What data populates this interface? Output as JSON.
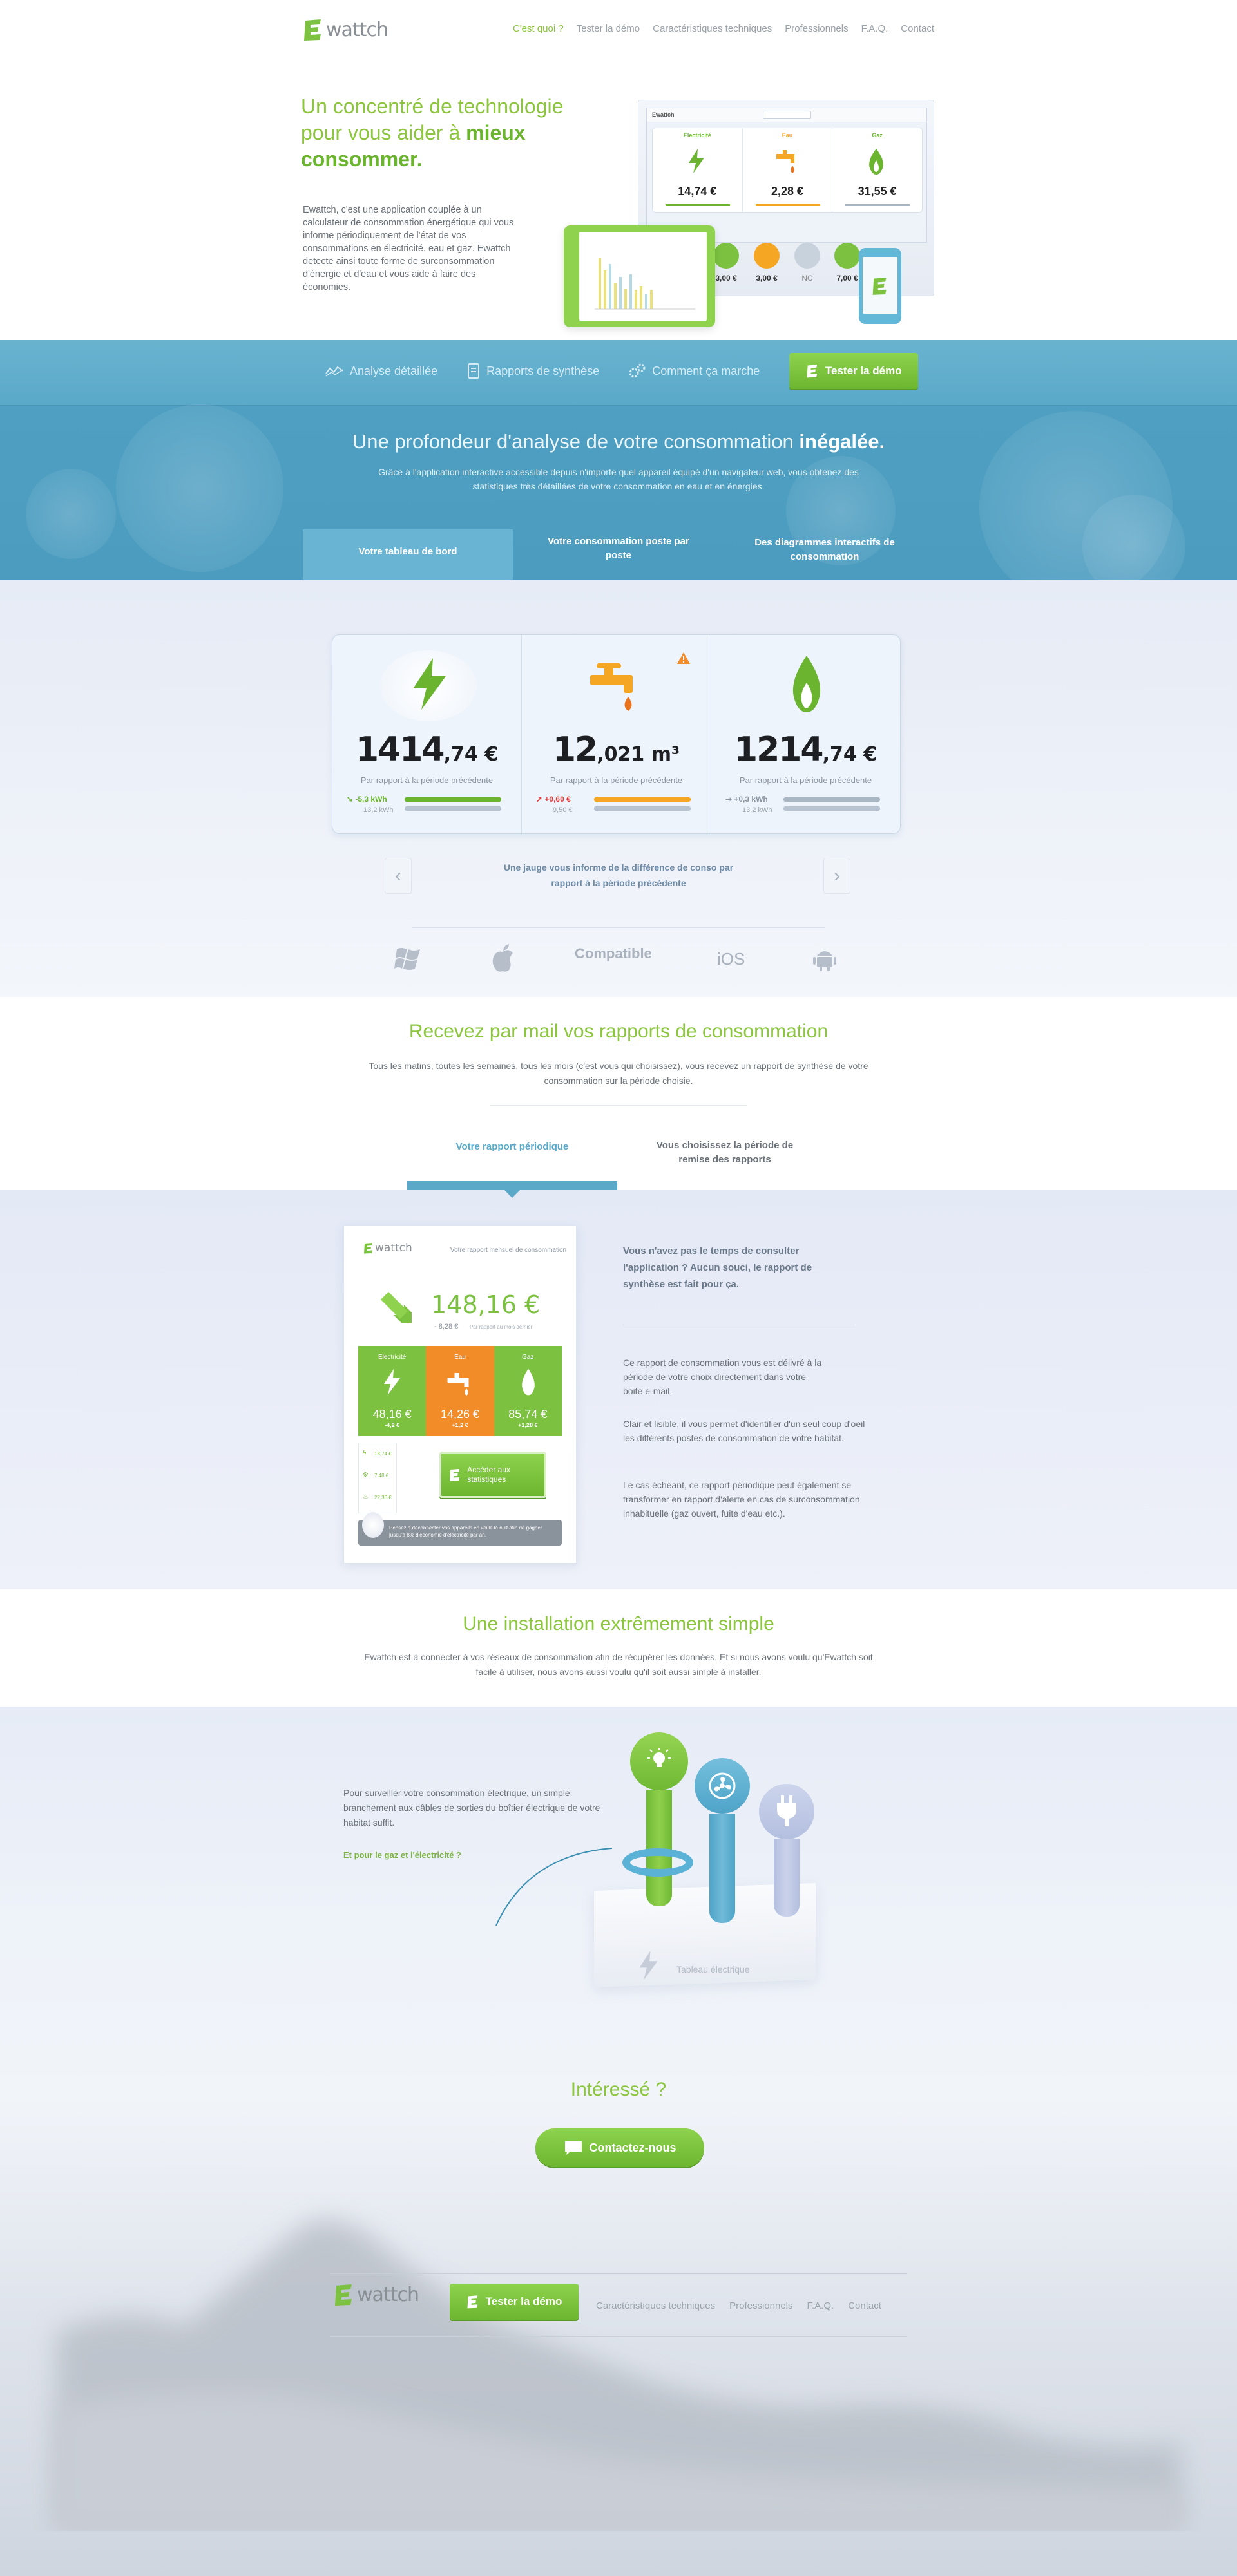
{
  "header": {
    "logo_text": "wattch",
    "nav": [
      "C'est quoi ?",
      "Tester la démo",
      "Caractéristiques techniques",
      "Professionnels",
      "F.A.Q.",
      "Contact"
    ]
  },
  "hero": {
    "title_part1": "Un concentré de technologie pour vous aider à ",
    "title_bold": "mieux consommer.",
    "text": "Ewattch, c'est une application couplée à un calculateur de consommation énergétique qui vous informe périodiquement de l'état de vos consommations en électricité, eau et gaz. Ewattch detecte ainsi toute forme de surconsommation d'énergie et d'eau et vous aide à faire des économies.",
    "mock": {
      "app_name": "Ewattch",
      "cards": [
        {
          "label": "Electricité",
          "value": "14,74 €"
        },
        {
          "label": "Eau",
          "value": "2,28 €"
        },
        {
          "label": "Gaz",
          "value": "31,55 €"
        }
      ],
      "widgets": [
        "3,00 €",
        "3,00 €",
        "NC",
        "7,00 €"
      ]
    }
  },
  "band": {
    "nav": [
      "Analyse détaillée",
      "Rapports de synthèse",
      "Comment ça marche"
    ],
    "demo_button": "Tester la démo",
    "title": "Une profondeur d'analyse de votre consommation ",
    "title_bold": "inégalée.",
    "subtitle": "Grâce à l'application interactive accessible depuis n'importe quel appareil équipé d'un navigateur web, vous obtenez des statistiques très détaillées de votre consommation en eau et en énergies.",
    "tabs": [
      "Votre tableau de bord",
      "Votre consommation poste par poste",
      "Des diagrammes interactifs de consommation"
    ]
  },
  "dashboard": {
    "columns": [
      {
        "name": "electricity",
        "int": "1414",
        "dec": ",74",
        "unit": " €",
        "caption": "Par rapport à la période précédente",
        "delta": "-5,3 kWh",
        "previous": "13,2 kWh",
        "delta_color": "#6ab42f",
        "bar_color": "#6ab42f"
      },
      {
        "name": "water",
        "int": "12",
        "dec": ",021",
        "unit": " m³",
        "caption": "Par rapport à la période précédente",
        "delta": "+0,60 €",
        "previous": "9,50 €",
        "delta_color": "#e53935",
        "bar_color": "#f5a623"
      },
      {
        "name": "gas",
        "int": "1214",
        "dec": ",74",
        "unit": " €",
        "caption": "Par rapport à la période précédente",
        "delta": "+0,3 kWh",
        "previous": "13,2 kWh",
        "delta_color": "#8a94a0",
        "bar_color": "#a9b6c4"
      }
    ],
    "caption": "Une jauge vous informe de la différence de conso par rapport à la période précédente",
    "compatible": "Compatible",
    "ios": "iOS"
  },
  "mail": {
    "title": "Recevez par mail vos rapports de consommation",
    "subtitle": "Tous les matins, toutes les semaines, tous les mois (c'est vous qui choisissez), vous recevez un rapport de synthèse de votre consommation sur la période choisie.",
    "tabs": [
      "Votre rapport périodique",
      "Vous choisissez la période de remise des rapports"
    ]
  },
  "report": {
    "logo": "wattch",
    "heading": "Votre rapport mensuel de consommation",
    "total": "148,16 €",
    "total_delta": "- 8,28 €",
    "total_note": "Par rapport au mois dernier",
    "cards": [
      {
        "label": "Electricité",
        "value": "48,16 €",
        "delta": "-4,2 €"
      },
      {
        "label": "Eau",
        "value": "14,26 €",
        "delta": "+1,2 €"
      },
      {
        "label": "Gaz",
        "value": "85,74 €",
        "delta": "+1,28 €"
      }
    ],
    "details": [
      "18,74 €",
      "7,48 €",
      "22,36 €"
    ],
    "stats_button": "Accéder aux statistiques",
    "tip": "Pensez à déconnecter vos appareils en veille la nuit afin de gagner jusqu'à 8% d'économie d'électricité par an."
  },
  "report_text": {
    "lead": "Vous n'avez pas le temps de consulter l'application ? Aucun souci, le rapport de synthèse est fait pour ça.",
    "p1": "Ce rapport de consommation vous est délivré à la période de votre choix directement dans votre boite e-mail.",
    "p2": "Clair et lisible, il vous permet d'identifier d'un seul coup d'oeil les différents postes de consommation de votre habitat.",
    "p3": "Le cas échéant, ce rapport périodique peut également se transformer en rapport d'alerte en cas de surconsommation inhabituelle (gaz ouvert, fuite d'eau etc.)."
  },
  "install": {
    "title": "Une installation extrêmement simple",
    "subtitle": "Ewattch est à connecter à vos réseaux de consommation afin de récupérer les données. Et si nous avons voulu qu'Ewattch soit facile à utiliser, nous avons aussi voulu qu'il soit aussi simple à installer.",
    "text": "Pour surveiller votre consommation électrique, un simple branchement aux câbles de sorties du boîtier électrique de votre habitat suffit.",
    "link": "Et pour le gaz et l'électricité ?",
    "box_label": "Tableau électrique"
  },
  "cta": {
    "title": "Intéressé ?",
    "button": "Contactez-nous"
  },
  "footer": {
    "logo_text": "wattch",
    "demo_button": "Tester la démo",
    "nav": [
      "Caractéristiques techniques",
      "Professionnels",
      "F.A.Q.",
      "Contact"
    ]
  }
}
